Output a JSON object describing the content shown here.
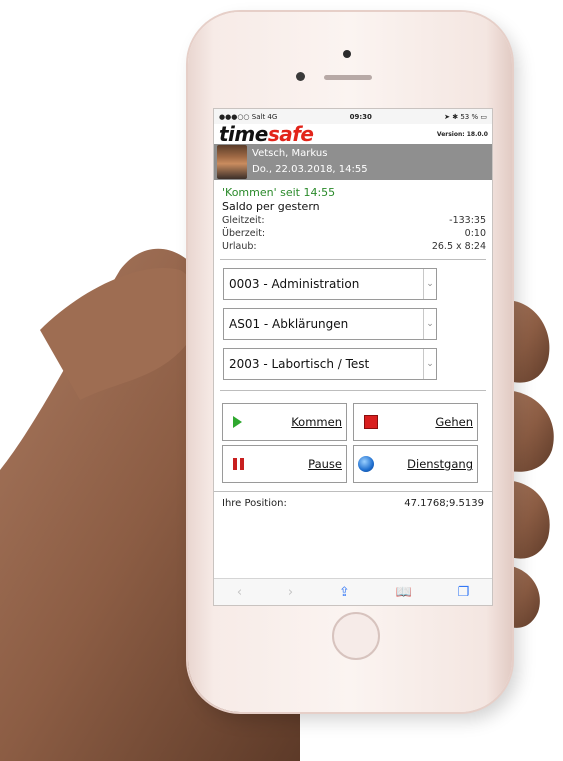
{
  "status_bar": {
    "carrier": "●●●○○ Salt  4G",
    "time": "09:30",
    "battery": "53 %"
  },
  "brand": {
    "logo_part1": "time",
    "logo_part2": "safe",
    "version": "Version: 18.0.0"
  },
  "user": {
    "name": "Vetsch, Markus",
    "datetime": "Do., 22.03.2018, 14:55"
  },
  "status": {
    "since": "'Kommen' seit 14:55",
    "saldo_title": "Saldo per gestern"
  },
  "balances": [
    {
      "label": "Gleitzeit:",
      "value": "-133:35"
    },
    {
      "label": "Überzeit:",
      "value": "0:10"
    },
    {
      "label": "Urlaub:",
      "value": "26.5 x 8:24"
    }
  ],
  "selects": [
    {
      "value": "0003 - Administration"
    },
    {
      "value": "AS01 - Abklärungen"
    },
    {
      "value": "2003 - Labortisch / Test"
    }
  ],
  "buttons": {
    "kommen": "Kommen",
    "gehen": "Gehen",
    "pause": "Pause",
    "dienstgang": "Dienstgang"
  },
  "position": {
    "label": "Ihre Position:",
    "value": "47.1768;9.5139"
  },
  "toolbar_icons": [
    "back-icon",
    "forward-icon",
    "share-icon",
    "bookmarks-icon",
    "tabs-icon"
  ]
}
